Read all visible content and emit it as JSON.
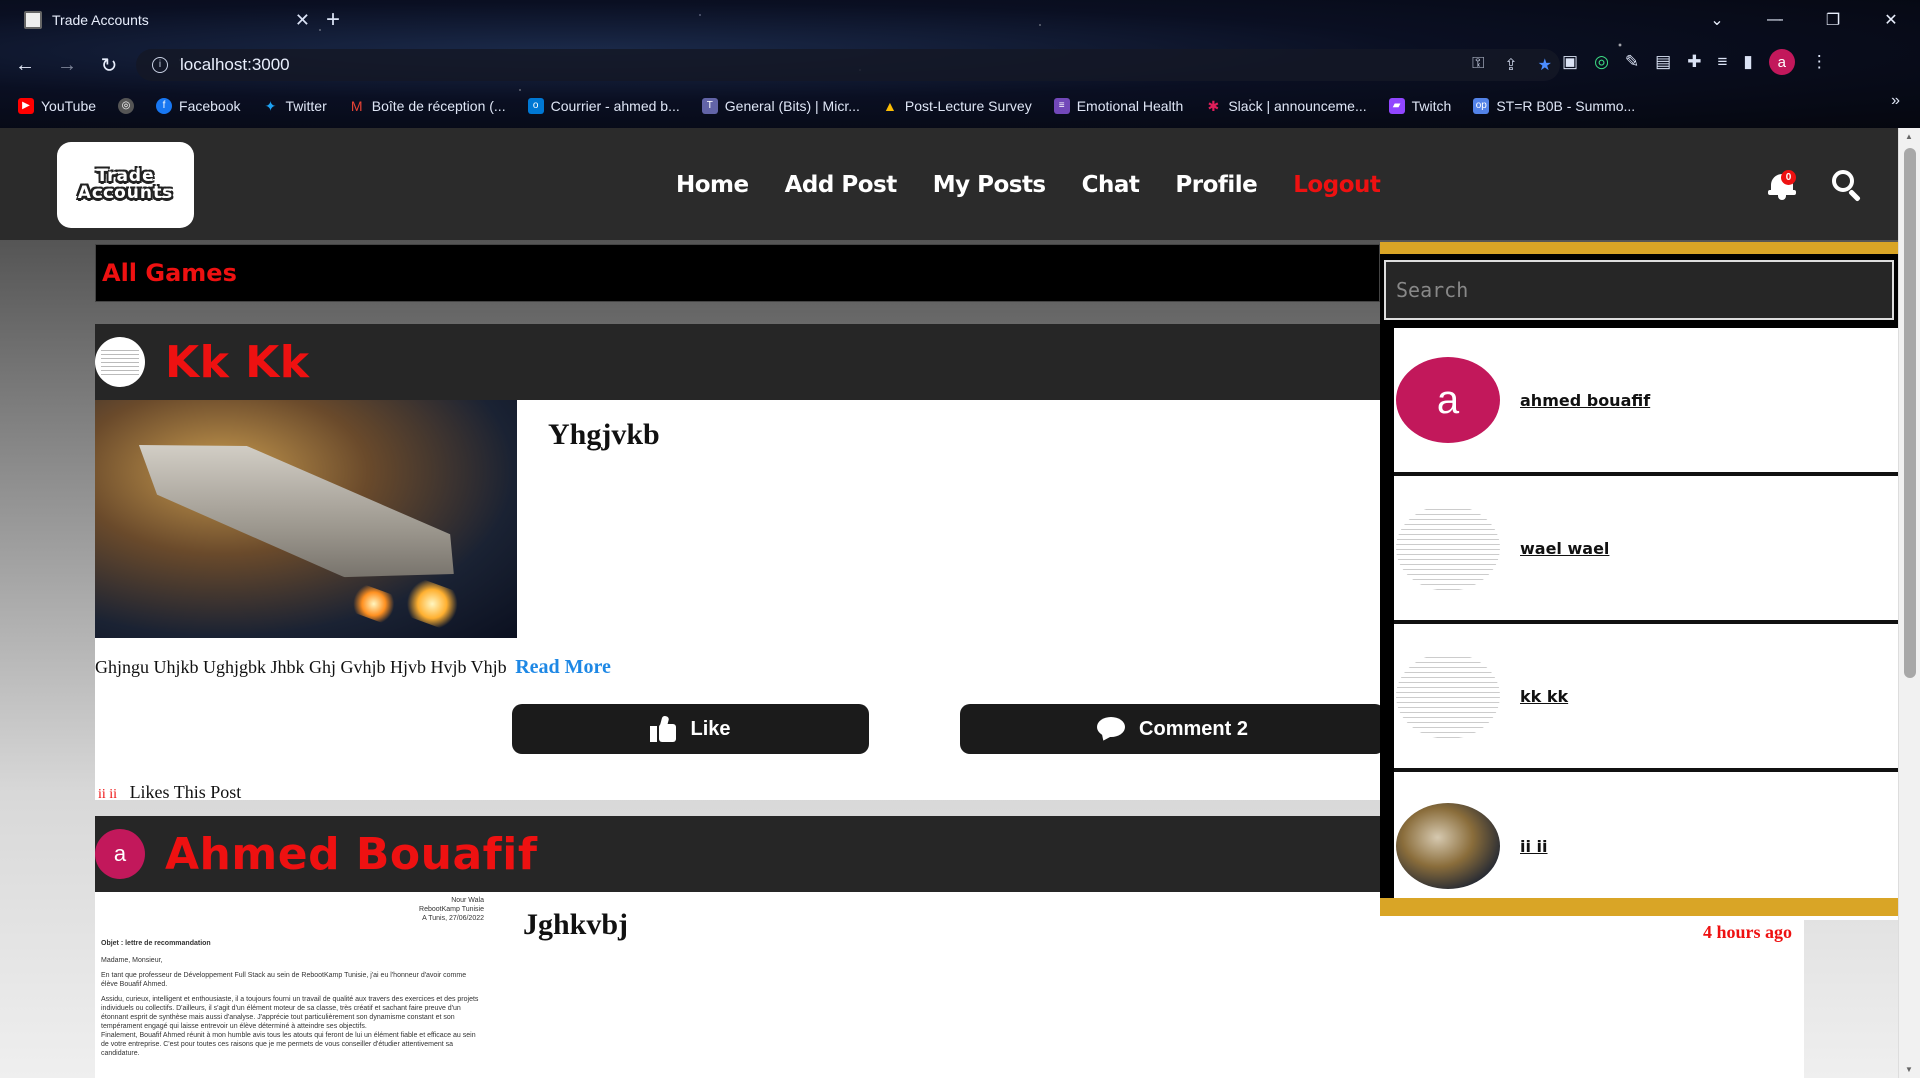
{
  "browser": {
    "tab_title": "Trade Accounts",
    "tab_close": "✕",
    "new_tab": "+",
    "window_controls": [
      "⌄",
      "—",
      "❐",
      "✕"
    ],
    "url": "localhost:3000",
    "profile_letter": "a",
    "bookmarks": [
      {
        "label": "YouTube",
        "icon": "youtube-icon",
        "color": "#ff0000"
      },
      {
        "label": "",
        "icon": "globe-icon",
        "color": "#888888"
      },
      {
        "label": "Facebook",
        "icon": "facebook-icon",
        "color": "#1877f2"
      },
      {
        "label": "Twitter",
        "icon": "twitter-icon",
        "color": "#1da1f2"
      },
      {
        "label": "Boîte de réception (...",
        "icon": "gmail-icon",
        "color": "#ea4335"
      },
      {
        "label": "Courrier - ahmed b...",
        "icon": "outlook-icon",
        "color": "#0078d4"
      },
      {
        "label": "General (Bits) | Micr...",
        "icon": "teams-icon",
        "color": "#6264a7"
      },
      {
        "label": "Post-Lecture Survey",
        "icon": "drive-icon",
        "color": "#fbbc04"
      },
      {
        "label": "Emotional Health",
        "icon": "forms-icon",
        "color": "#7248b9"
      },
      {
        "label": "Slack | announceme...",
        "icon": "slack-icon",
        "color": "#e01e5a"
      },
      {
        "label": "Twitch",
        "icon": "twitch-icon",
        "color": "#9146ff"
      },
      {
        "label": "ST=R B0B - Summo...",
        "icon": "opgg-icon",
        "color": "#5383e8"
      }
    ],
    "bookmarks_more": "»"
  },
  "header": {
    "logo_line1": "Trade",
    "logo_line2": "Accounts",
    "nav": [
      "Home",
      "Add Post",
      "My Posts",
      "Chat",
      "Profile",
      "Logout"
    ],
    "notification_count": "0"
  },
  "feed": {
    "section_title": "All Games",
    "posts": [
      {
        "author": "Kk Kk",
        "title": "Yhgjvkb",
        "text": "Ghjngu Uhjkb Ughjgbk Jhbk Ghj Gvhjb Hjvb Hvjb Vhjb",
        "read_more": "Read More",
        "like_label": "Like",
        "comment_label": "Comment 2",
        "likers": "ii ii",
        "likes_suffix": "Likes This Post"
      },
      {
        "author": "Ahmed Bouafif",
        "author_initial": "a",
        "title": "Jghkvbj",
        "doc_right": [
          "Nour Wala",
          "RebootKamp Tunisie",
          "A Tunis, 27/06/2022"
        ],
        "doc_subject": "Objet : lettre de recommandation",
        "doc_lines": [
          "Madame, Monsieur,",
          "En tant que professeur de Développement Full Stack au sein de RebootKamp Tunisie, j'ai eu l'honneur d'avoir comme élève Bouafif Ahmed.",
          "Assidu, curieux, intelligent et enthousiaste, il a toujours fourni un travail de qualité aux travers des exercices et des projets individuels ou collectifs. D'ailleurs, il s'agit d'un élément moteur de sa classe, très créatif et sachant faire preuve d'un étonnant esprit de synthèse mais aussi d'analyse. J'apprécie tout particulièrement son dynamisme constant et son tempérament engagé qui laisse entrevoir un élève déterminé à atteindre ses objectifs.",
          "Finalement, Bouafif Ahmed réunit à mon humble avis tous les atouts qui feront de lui un élément fiable et efficace au sein de votre entreprise. C'est pour toutes ces raisons que je me permets de vous conseiller d'étudier attentivement sa candidature."
        ]
      }
    ]
  },
  "search_overlay": {
    "placeholder": "Search",
    "results": [
      {
        "name": "ahmed bouafif",
        "avatar": "letter",
        "initial": "a"
      },
      {
        "name": "wael wael",
        "avatar": "doc"
      },
      {
        "name": "kk kk",
        "avatar": "doc"
      },
      {
        "name": "ii ii",
        "avatar": "ship"
      }
    ],
    "accent_color": "#d9a526"
  },
  "time_ago": "4 hours ago"
}
